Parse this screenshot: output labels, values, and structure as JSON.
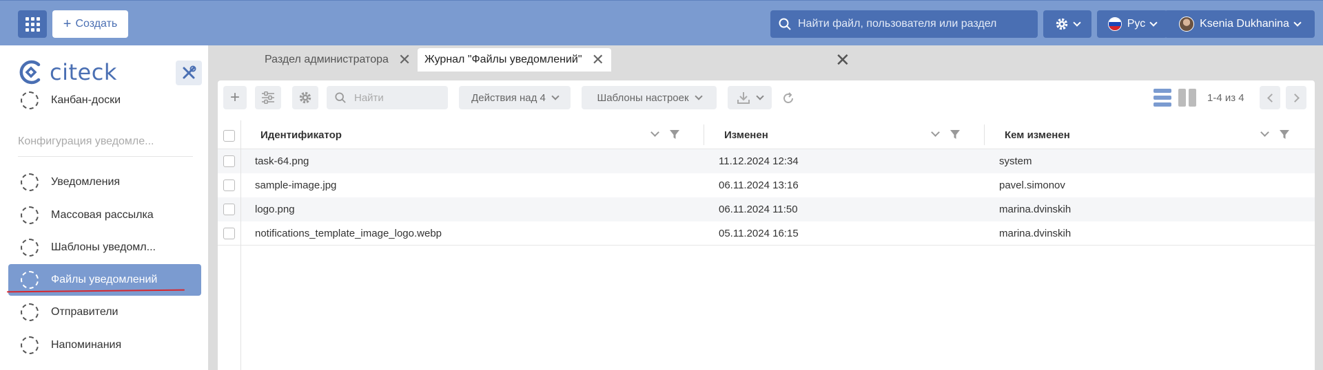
{
  "header": {
    "create_label": "Создать",
    "search_placeholder": "Найти файл, пользователя или раздел",
    "lang_label": "Рус",
    "user_name": "Ksenia Dukhanina"
  },
  "sidebar": {
    "logo_text": "citeck",
    "items": [
      {
        "label": "Канбан-доски"
      },
      {
        "label": "Уведомления"
      },
      {
        "label": "Массовая рассылка"
      },
      {
        "label": "Шаблоны уведомл..."
      },
      {
        "label": "Файлы уведомлений"
      },
      {
        "label": "Отправители"
      },
      {
        "label": "Напоминания"
      }
    ],
    "section_label": "Конфигурация уведомле..."
  },
  "tabs": [
    {
      "label": "Раздел администратора"
    },
    {
      "label": "Журнал \"Файлы уведомлений\""
    }
  ],
  "toolbar": {
    "search_placeholder": "Найти",
    "actions_label": "Действия над 4",
    "templates_label": "Шаблоны настроек",
    "pager_text": "1-4 из 4"
  },
  "table": {
    "columns": [
      "Идентификатор",
      "Изменен",
      "Кем изменен"
    ],
    "rows": [
      [
        "task-64.png",
        "11.12.2024 12:34",
        "system"
      ],
      [
        "sample-image.jpg",
        "06.11.2024 13:16",
        "pavel.simonov"
      ],
      [
        "logo.png",
        "06.11.2024 11:50",
        "marina.dvinskih"
      ],
      [
        "notifications_template_image_logo.webp",
        "05.11.2024 16:15",
        "marina.dvinskih"
      ]
    ]
  },
  "colors": {
    "header_bg": "#7b9bd0",
    "accent": "#4a6fb3",
    "active_item": "#7b9bd0",
    "underline": "#d8262c"
  }
}
